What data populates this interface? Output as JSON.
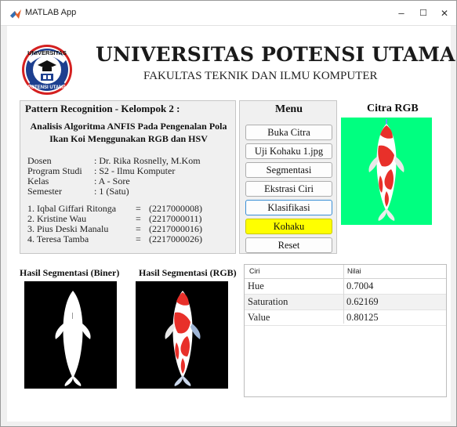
{
  "window": {
    "title": "MATLAB App",
    "controls": {
      "minimize": "–",
      "maximize": "☐",
      "close": "✕"
    }
  },
  "header": {
    "logo": {
      "top_text": "UNIVERSITAS",
      "bottom_text": "POTENSI UTAMA"
    },
    "university": "UNIVERSITAS POTENSI UTAMA",
    "faculty": "FAKULTAS TEKNIK DAN ILMU KOMPUTER"
  },
  "info": {
    "panel_title": "Pattern Recognition - Kelompok 2 :",
    "title_line1": "Analisis Algoritma ANFIS Pada Pengenalan Pola",
    "title_line2": "Ikan Koi Menggunakan RGB dan HSV",
    "fields": [
      {
        "label": "Dosen",
        "value": ": Dr. Rika Rosnelly, M.Kom"
      },
      {
        "label": "Program Studi",
        "value": ": S2 - Ilmu Komputer"
      },
      {
        "label": "Kelas",
        "value": ": A - Sore"
      },
      {
        "label": "Semester",
        "value": ": 1 (Satu)"
      }
    ],
    "members": [
      {
        "name": "1. Iqbal Giffari Ritonga",
        "eq": "=",
        "nim": "(2217000008)"
      },
      {
        "name": "2. Kristine Wau",
        "eq": "=",
        "nim": "(2217000011)"
      },
      {
        "name": "3. Pius Deski Manalu",
        "eq": "=",
        "nim": "(2217000016)"
      },
      {
        "name": "4. Teresa Tamba",
        "eq": "=",
        "nim": "(2217000026)"
      }
    ]
  },
  "menu": {
    "title": "Menu",
    "buttons": [
      "Buka Citra",
      "Uji Kohaku 1.jpg",
      "Segmentasi",
      "Ekstrasi Ciri",
      "Klasifikasi",
      "Kohaku",
      "Reset"
    ]
  },
  "images": {
    "rgb_title": "Citra RGB",
    "biner_title": "Hasil Segmentasi (Biner)",
    "seg_rgb_title": "Hasil Segmentasi (RGB)"
  },
  "colors": {
    "rgb_background": "#00ff80",
    "result_highlight": "#ffff00",
    "koi_red": "#e8302a"
  },
  "table": {
    "headers": [
      "Ciri",
      "Nilai"
    ],
    "rows": [
      [
        "Hue",
        "0.7004"
      ],
      [
        "Saturation",
        "0.62169"
      ],
      [
        "Value",
        "0.80125"
      ]
    ]
  }
}
